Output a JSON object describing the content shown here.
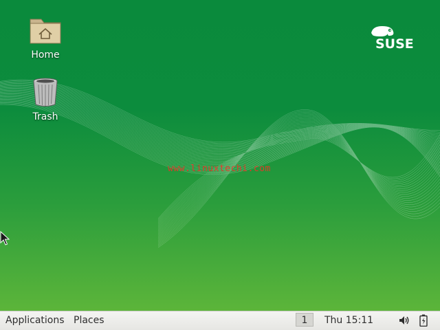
{
  "desktop": {
    "icons": [
      {
        "label": "Home",
        "icon": "home-folder-icon"
      },
      {
        "label": "Trash",
        "icon": "trash-can-icon"
      }
    ],
    "watermark": "www.linuxtechi.com",
    "logo_text": "SUSE",
    "colors": {
      "wallpaper_top": "#0a8a3c",
      "wallpaper_bottom": "#5cb53a",
      "watermark": "#e03a2a"
    }
  },
  "panel": {
    "applications_label": "Applications",
    "places_label": "Places",
    "workspace": "1",
    "clock": "Thu 15:11",
    "tray_icons": [
      "volume-icon",
      "battery-icon"
    ]
  }
}
